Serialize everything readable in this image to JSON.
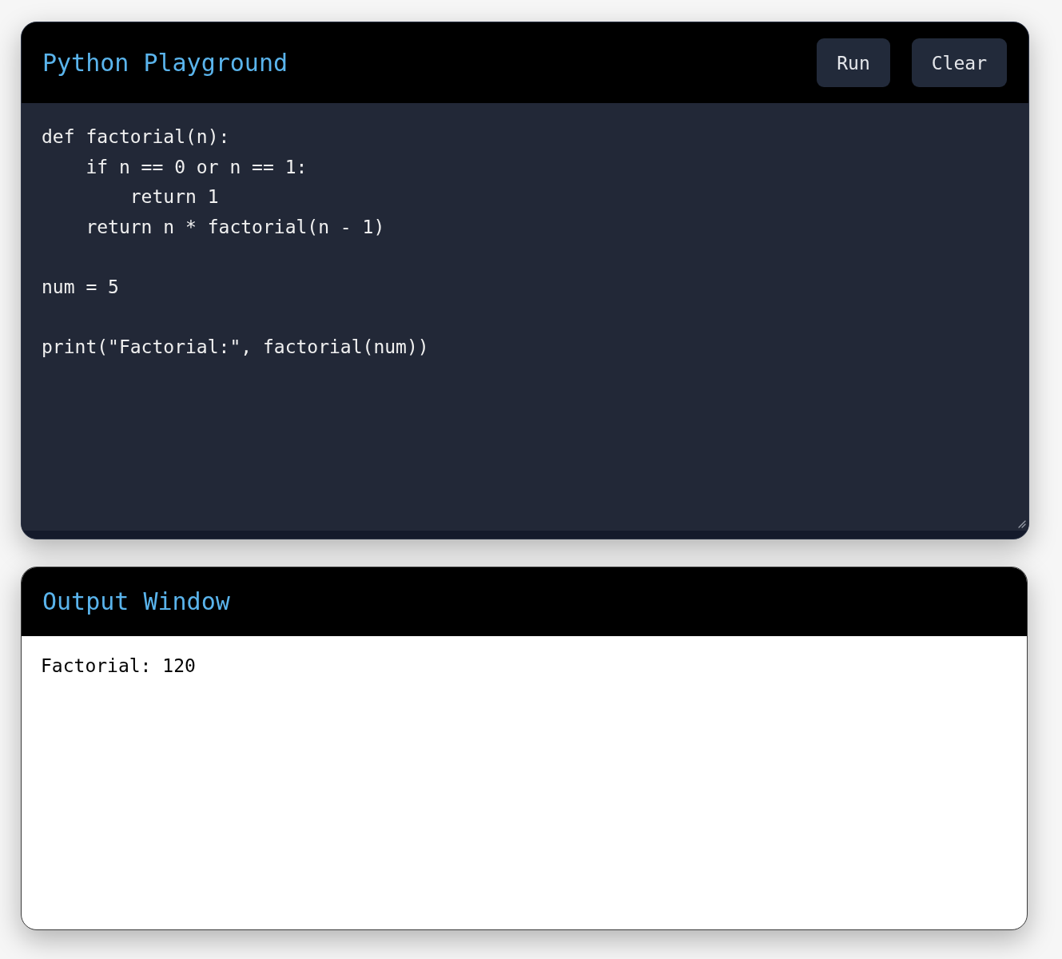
{
  "editor_panel": {
    "title": "Python Playground",
    "buttons": [
      "Run",
      "Clear"
    ],
    "code": "def factorial(n):\n    if n == 0 or n == 1:\n        return 1\n    return n * factorial(n - 1)\n\nnum = 5\n\nprint(\"Factorial:\", factorial(num))"
  },
  "output_panel": {
    "title": "Output Window",
    "text": "Factorial: 120"
  }
}
